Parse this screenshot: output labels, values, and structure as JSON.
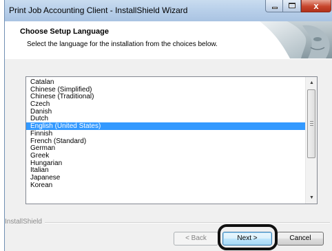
{
  "window": {
    "title": "Print Job Accounting Client - InstallShield Wizard",
    "controls": {
      "minimize": "minimize-icon",
      "maximize": "maximize-icon",
      "close": "close-icon",
      "close_glyph": "x"
    }
  },
  "header": {
    "title": "Choose Setup Language",
    "subtitle": "Select the language for the installation from the choices below.",
    "art": "installshield-face-art"
  },
  "language_list": {
    "items": [
      "Catalan",
      "Chinese (Simplified)",
      "Chinese (Traditional)",
      "Czech",
      "Danish",
      "Dutch",
      "English (United States)",
      "Finnish",
      "French (Standard)",
      "German",
      "Greek",
      "Hungarian",
      "Italian",
      "Japanese",
      "Korean"
    ],
    "selected": "English (United States)",
    "scroll_up_glyph": "▲",
    "scroll_down_glyph": "▼"
  },
  "footer": {
    "brand": "InstallShield",
    "back_label": "< Back",
    "next_label": "Next >",
    "cancel_label": "Cancel"
  },
  "colors": {
    "selection": "#3399ff",
    "title_bar": "#b9d0ea",
    "close_button": "#c7452c",
    "highlight_ring": "#111111"
  }
}
